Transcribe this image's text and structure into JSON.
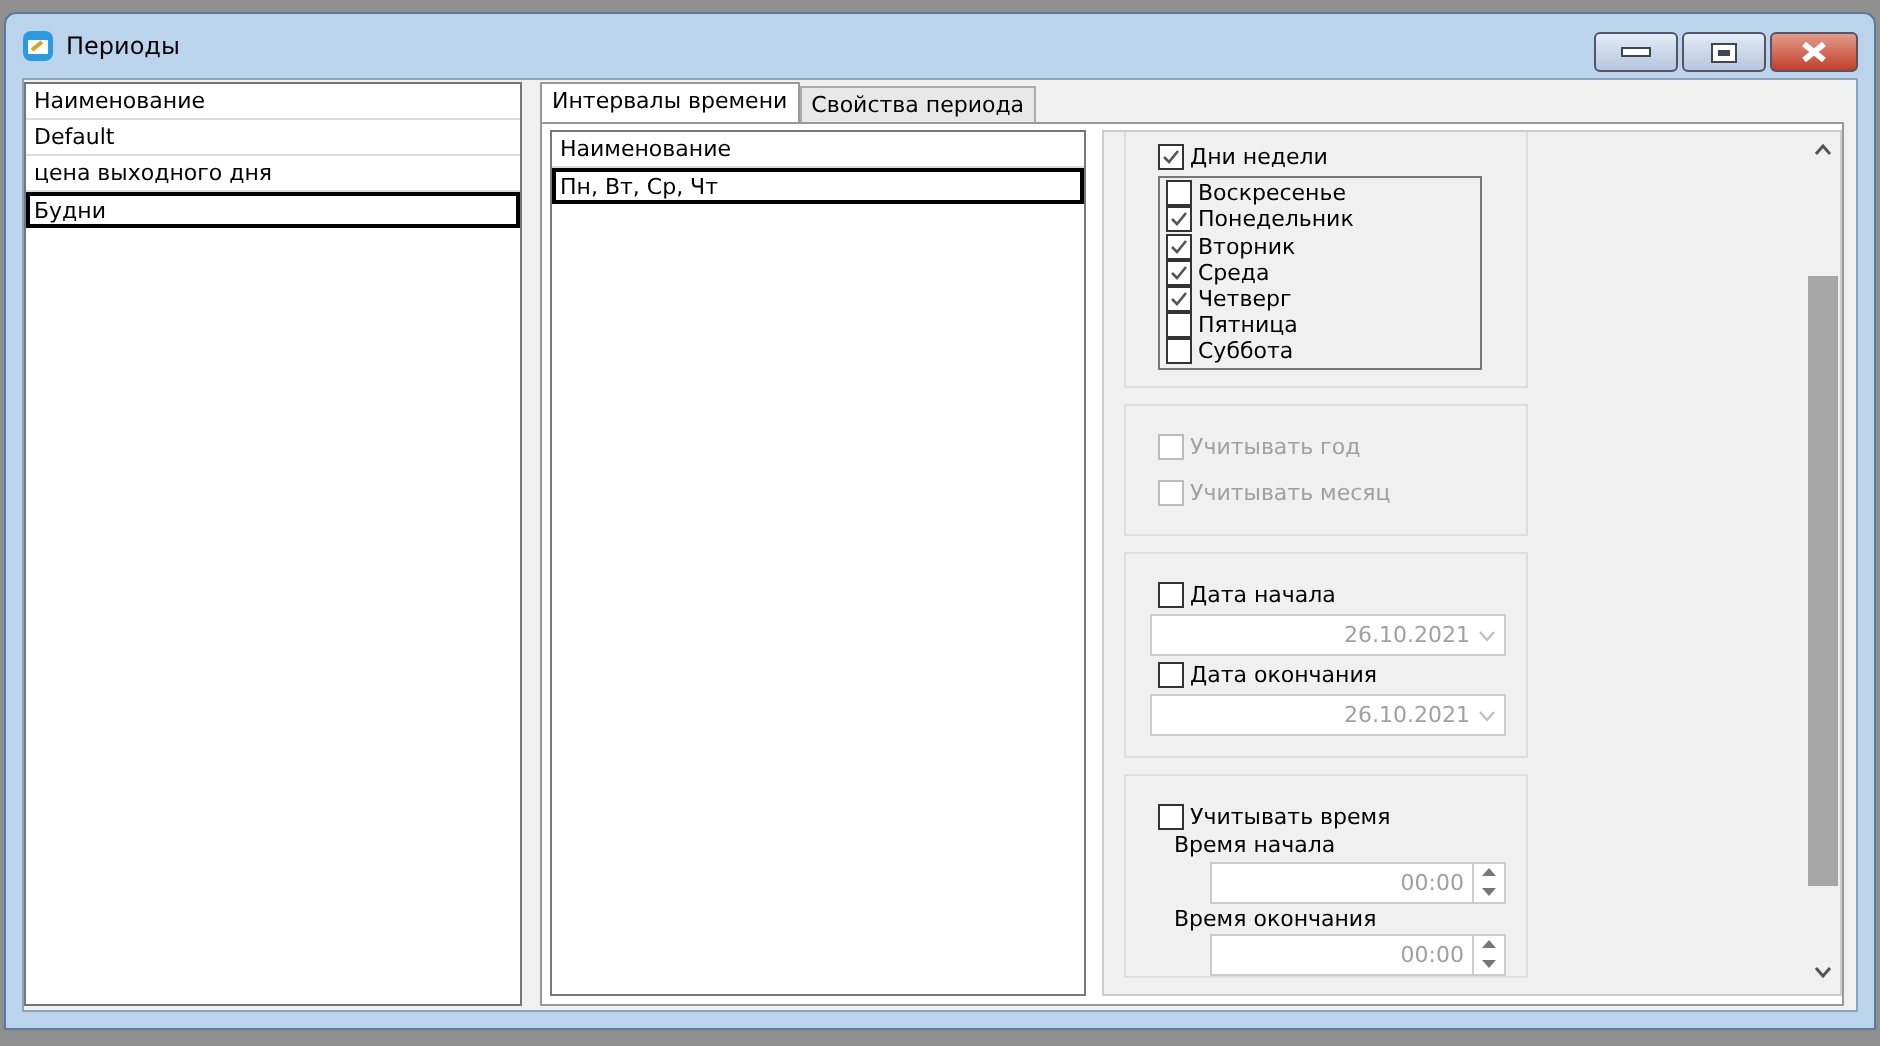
{
  "window": {
    "title": "Периоды"
  },
  "periods": {
    "header": "Наименование",
    "items": [
      {
        "label": "Default",
        "selected": false
      },
      {
        "label": "цена выходного дня",
        "selected": false
      },
      {
        "label": "Будни",
        "selected": true
      }
    ]
  },
  "tabs": [
    {
      "label": "Интервалы времени",
      "selected": true
    },
    {
      "label": "Свойства периода",
      "selected": false
    }
  ],
  "intervals": {
    "header": "Наименование",
    "items": [
      {
        "label": "Пн, Вт, Ср, Чт",
        "selected": true
      }
    ]
  },
  "weekdays": {
    "label": "Дни недели",
    "checked": true,
    "days": [
      {
        "label": "Воскресенье",
        "checked": false
      },
      {
        "label": "Понедельник",
        "checked": true
      },
      {
        "label": "Вторник",
        "checked": true
      },
      {
        "label": "Среда",
        "checked": true
      },
      {
        "label": "Четверг",
        "checked": true
      },
      {
        "label": "Пятница",
        "checked": false
      },
      {
        "label": "Суббота",
        "checked": false
      }
    ]
  },
  "year_month": [
    {
      "label": "Учитывать год",
      "checked": false,
      "disabled": true
    },
    {
      "label": "Учитывать месяц",
      "checked": false,
      "disabled": true
    }
  ],
  "dates": [
    {
      "label": "Дата начала",
      "checked": false,
      "value": "26.10.2021"
    },
    {
      "label": "Дата окончания",
      "checked": false,
      "value": "26.10.2021"
    }
  ],
  "time": {
    "label": "Учитывать время",
    "checked": false,
    "fields": [
      {
        "label": "Время начала",
        "value": "00:00"
      },
      {
        "label": "Время окончания",
        "value": "00:00"
      }
    ]
  }
}
